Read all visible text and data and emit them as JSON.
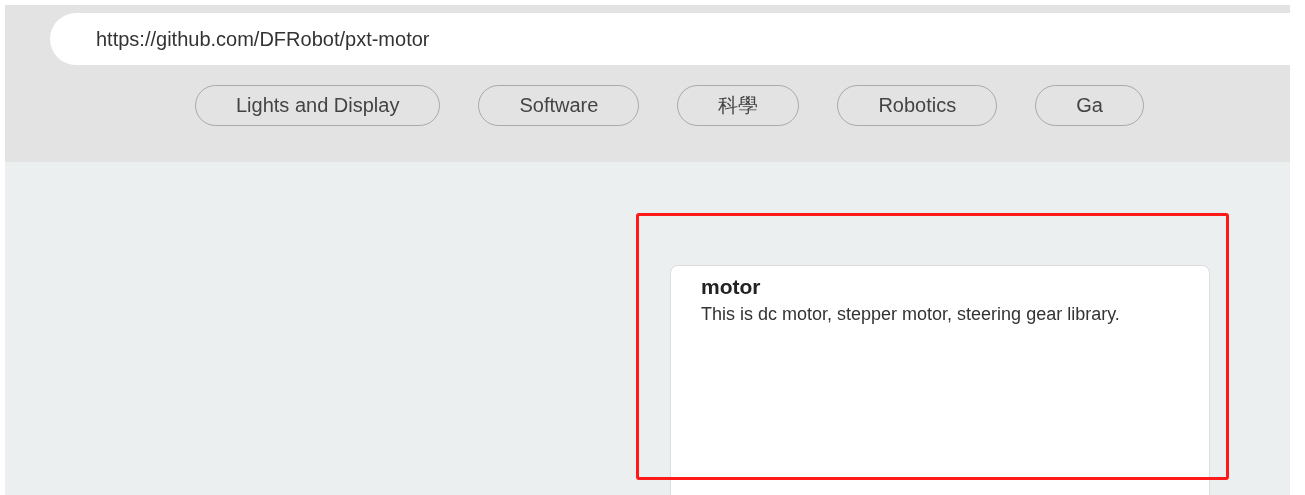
{
  "search": {
    "value": "https://github.com/DFRobot/pxt-motor"
  },
  "categories": [
    {
      "label": "Lights and Display"
    },
    {
      "label": "Software"
    },
    {
      "label": "科學"
    },
    {
      "label": "Robotics"
    },
    {
      "label": "Ga"
    }
  ],
  "extension_card": {
    "title": "motor",
    "description": "This is dc motor, stepper motor, steering gear library.",
    "highlighted": true
  }
}
